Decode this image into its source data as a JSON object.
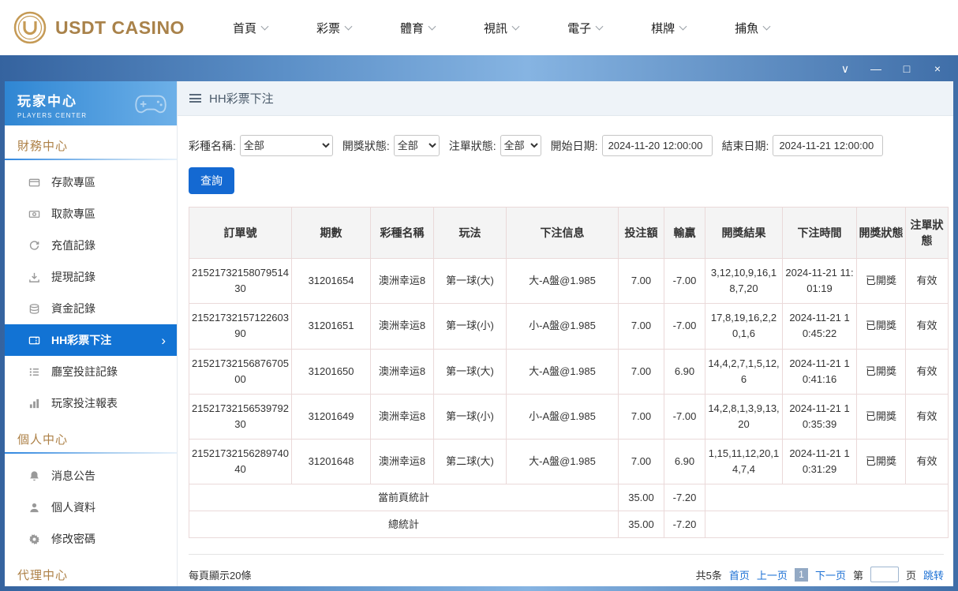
{
  "topbar": {
    "logo_text": "USDT CASINO",
    "nav_items": [
      {
        "label": "首頁"
      },
      {
        "label": "彩票"
      },
      {
        "label": "體育"
      },
      {
        "label": "視訊"
      },
      {
        "label": "電子"
      },
      {
        "label": "棋牌"
      },
      {
        "label": "捕魚"
      }
    ]
  },
  "window_controls": {
    "collapse": "∨",
    "minimize": "—",
    "maximize": "□",
    "close": "×"
  },
  "sidebar": {
    "title": "玩家中心",
    "subtitle": "PLAYERS CENTER",
    "sections": [
      {
        "title": "財務中心",
        "items": [
          {
            "id": "deposit",
            "icon": "deposit-icon",
            "label": "存款專區",
            "active": false
          },
          {
            "id": "withdraw",
            "icon": "withdraw-icon",
            "label": "取款專區",
            "active": false
          },
          {
            "id": "recharge-record",
            "icon": "recharge-record-icon",
            "label": "充值記錄",
            "active": false
          },
          {
            "id": "withdrawal-record",
            "icon": "withdrawal-record-icon",
            "label": "提現記錄",
            "active": false
          },
          {
            "id": "funds-record",
            "icon": "funds-record-icon",
            "label": "資金記錄",
            "active": false
          },
          {
            "id": "hh-lottery-bet",
            "icon": "lottery-bet-icon",
            "label": "HH彩票下注",
            "active": true
          },
          {
            "id": "room-bet-record",
            "icon": "room-record-icon",
            "label": "廳室投註記錄",
            "active": false
          },
          {
            "id": "player-bet-report",
            "icon": "report-icon",
            "label": "玩家投注報表",
            "active": false
          }
        ]
      },
      {
        "title": "個人中心",
        "items": [
          {
            "id": "messages",
            "icon": "bell-icon",
            "label": "消息公告",
            "active": false
          },
          {
            "id": "profile",
            "icon": "person-icon",
            "label": "個人資料",
            "active": false
          },
          {
            "id": "change-password",
            "icon": "gear-icon",
            "label": "修改密碼",
            "active": false
          }
        ]
      },
      {
        "title": "代理中心",
        "items": []
      }
    ]
  },
  "main": {
    "breadcrumb": "HH彩票下注",
    "filters": {
      "lottery_label": "彩種名稱:",
      "lottery_value": "全部",
      "draw_status_label": "開獎狀態:",
      "draw_status_value": "全部",
      "order_status_label": "注單狀態:",
      "order_status_value": "全部",
      "start_label": "開始日期:",
      "start_value": "2024-11-20 12:00:00",
      "end_label": "結束日期:",
      "end_value": "2024-11-21 12:00:00",
      "search_button": "查詢"
    },
    "table": {
      "headers": [
        "訂單號",
        "期數",
        "彩種名稱",
        "玩法",
        "下注信息",
        "投注額",
        "輸贏",
        "開獎結果",
        "下注時間",
        "開獎狀態",
        "注單狀態"
      ],
      "rows": [
        {
          "cells": [
            "2152173215807951430",
            "31201654",
            "澳洲幸运8",
            "第一球(大)",
            "大-A盤@1.985",
            "7.00",
            "-7.00",
            "3,12,10,9,16,18,7,20",
            "2024-11-21 11:01:19",
            "已開獎",
            "有效"
          ]
        },
        {
          "cells": [
            "2152173215712260390",
            "31201651",
            "澳洲幸运8",
            "第一球(小)",
            "小-A盤@1.985",
            "7.00",
            "-7.00",
            "17,8,19,16,2,20,1,6",
            "2024-11-21 10:45:22",
            "已開獎",
            "有效"
          ]
        },
        {
          "cells": [
            "2152173215687670500",
            "31201650",
            "澳洲幸运8",
            "第一球(大)",
            "大-A盤@1.985",
            "7.00",
            "6.90",
            "14,4,2,7,1,5,12,6",
            "2024-11-21 10:41:16",
            "已開獎",
            "有效"
          ]
        },
        {
          "cells": [
            "2152173215653979230",
            "31201649",
            "澳洲幸运8",
            "第一球(小)",
            "小-A盤@1.985",
            "7.00",
            "-7.00",
            "14,2,8,1,3,9,13,20",
            "2024-11-21 10:35:39",
            "已開獎",
            "有效"
          ]
        },
        {
          "cells": [
            "2152173215628974040",
            "31201648",
            "澳洲幸运8",
            "第二球(大)",
            "大-A盤@1.985",
            "7.00",
            "6.90",
            "1,15,11,12,20,14,7,4",
            "2024-11-21 10:31:29",
            "已開獎",
            "有效"
          ]
        }
      ],
      "summary": [
        {
          "label": "當前頁統計",
          "bet": "35.00",
          "winloss": "-7.20"
        },
        {
          "label": "總統計",
          "bet": "35.00",
          "winloss": "-7.20"
        }
      ]
    },
    "footer": {
      "page_size_text": "每頁顯示20條",
      "total_text": "共5条",
      "first": "首页",
      "prev": "上一页",
      "current_page": "1",
      "next": "下一页",
      "jump_prefix": "第",
      "jump_suffix": "页",
      "jump_action": "跳转"
    }
  },
  "colors": {
    "accent_blue": "#1469d2",
    "sidebar_active_bg": "#1273d4",
    "gold_brand": "#a9824a",
    "section_title": "#ad8046",
    "table_border": "#ead9d9",
    "link_blue": "#1a6fd4",
    "titlebar_gradient_start": "#35639f",
    "titlebar_gradient_end": "#3f6ea8"
  }
}
